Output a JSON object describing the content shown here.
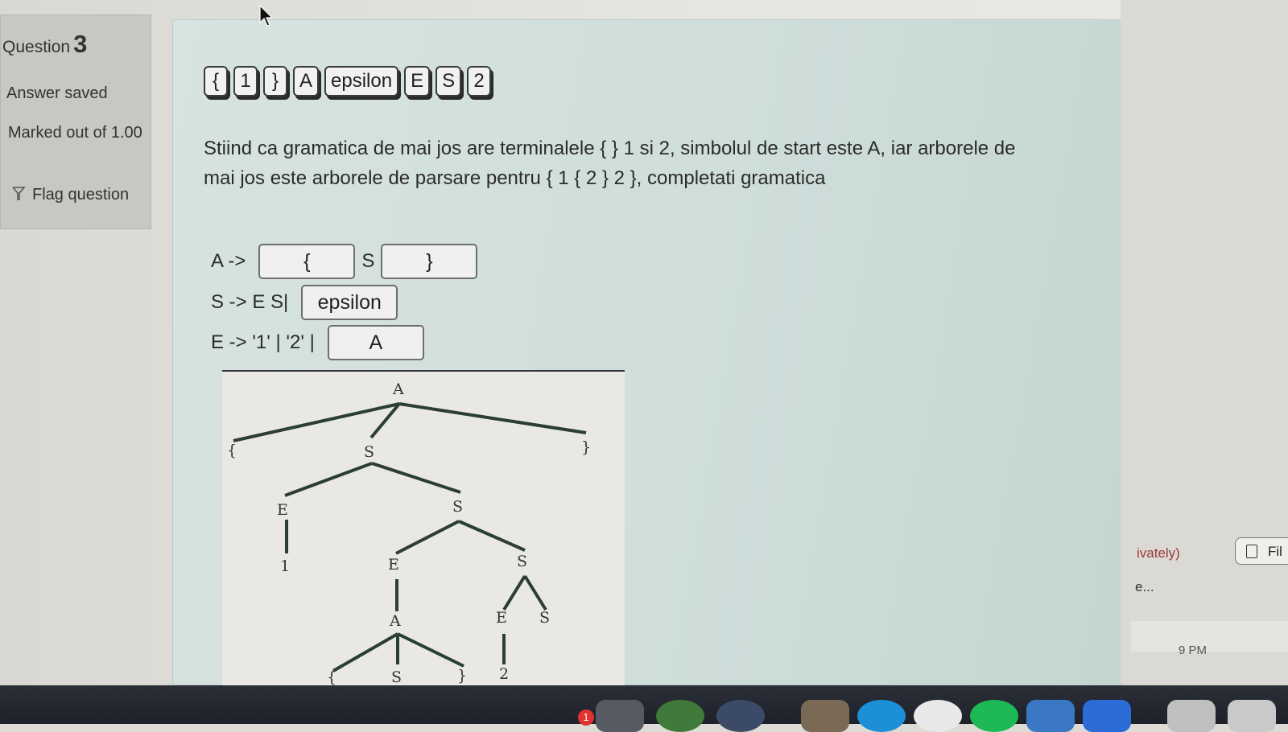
{
  "sidebar": {
    "question_label": "Question",
    "question_number": "3",
    "status": "Answer saved",
    "marked_out_of": "Marked out of 1.00",
    "flag_label": "Flag question"
  },
  "tokens": [
    "{",
    "1",
    "}",
    "A",
    "epsilon",
    "E",
    "S",
    "2"
  ],
  "question": {
    "text": "Stiind ca gramatica de mai jos are terminalele { }  1 si 2, simbolul de start este A, iar arborele de mai jos este arborele de parsare pentru { 1 { 2 } 2 }, completati gramatica"
  },
  "grammar": {
    "rule_a_prefix": "A ->",
    "rule_a_blank1": "{",
    "rule_a_middle": "S",
    "rule_a_blank2": "}",
    "rule_s_prefix": "S -> E S|",
    "rule_s_blank": "epsilon",
    "rule_e_prefix": "E -> '1' | '2' |",
    "rule_e_blank": "A"
  },
  "tree": {
    "labels": [
      "A",
      "{",
      "S",
      "}",
      "E",
      "S",
      "1",
      "E",
      "S",
      "A",
      "E",
      "S",
      "{",
      "S",
      "}",
      "2"
    ]
  },
  "right_panel": {
    "privately_text": "ivately)",
    "file_label": "Fil",
    "ellipsis_text": "e...",
    "time": "9 PM"
  },
  "dock": {
    "badge_count": "1"
  }
}
